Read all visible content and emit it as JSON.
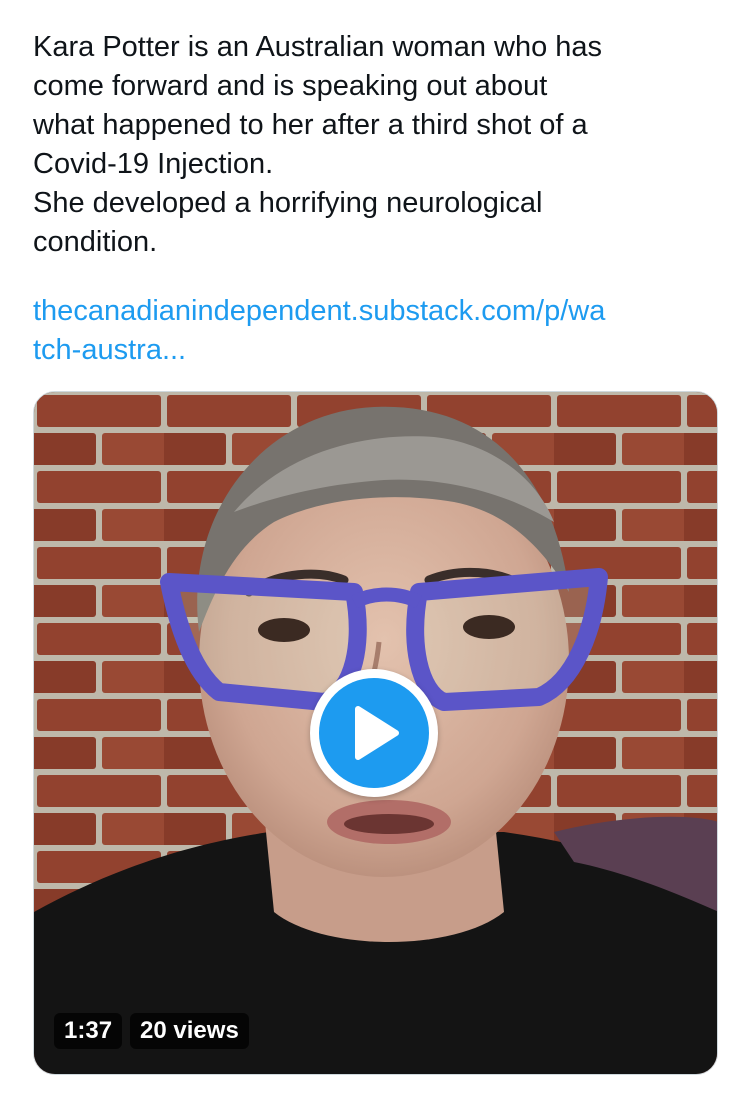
{
  "tweet": {
    "text_lines": [
      "Kara Potter is an Australian woman who has",
      "come forward and is speaking out about",
      "what happened to her after a third shot of a",
      "Covid-19 Injection.",
      "She developed a horrifying neurological",
      "condition."
    ],
    "link_lines": [
      "thecanadianindependent.substack.com/p/wa",
      "tch-austra..."
    ]
  },
  "media": {
    "duration": "1:37",
    "views": "20 views",
    "play_icon": "play-icon"
  },
  "colors": {
    "link": "#1d9bf0",
    "text": "#0f1419",
    "play_button": "#1d9bf0",
    "card_border": "#cfd9de"
  }
}
